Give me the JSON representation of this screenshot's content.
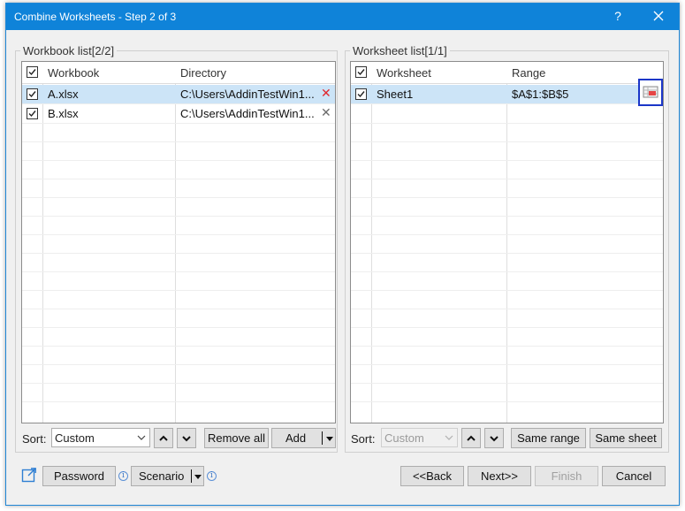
{
  "window": {
    "title": "Combine Worksheets - Step 2 of 3",
    "help_label": "?"
  },
  "workbook_panel": {
    "label": "Workbook list[2/2]",
    "columns": {
      "name": "Workbook",
      "directory": "Directory"
    },
    "rows": [
      {
        "name": "A.xlsx",
        "directory": "C:\\Users\\AddinTestWin1...",
        "checked": true,
        "selected": true
      },
      {
        "name": "B.xlsx",
        "directory": "C:\\Users\\AddinTestWin1...",
        "checked": true,
        "selected": false
      }
    ],
    "sort_label": "Sort:",
    "sort_value": "Custom",
    "remove_all_label": "Remove all",
    "add_label": "Add"
  },
  "worksheet_panel": {
    "label": "Worksheet list[1/1]",
    "columns": {
      "name": "Worksheet",
      "range": "Range"
    },
    "rows": [
      {
        "name": "Sheet1",
        "range": "$A$1:$B$5",
        "checked": true,
        "selected": true
      }
    ],
    "sort_label": "Sort:",
    "sort_value": "Custom",
    "same_range_label": "Same range",
    "same_sheet_label": "Same sheet"
  },
  "footer": {
    "password_label": "Password",
    "scenario_label": "Scenario",
    "info_glyph": "i",
    "back_label": "<<Back",
    "next_label": "Next>>",
    "finish_label": "Finish",
    "cancel_label": "Cancel"
  },
  "colors": {
    "titlebar": "#0f83d9",
    "selected_row": "#cce4f7",
    "remove_active": "#e0262d",
    "remove_inactive": "#6b6b6b",
    "highlight_border": "#1b36c8"
  }
}
